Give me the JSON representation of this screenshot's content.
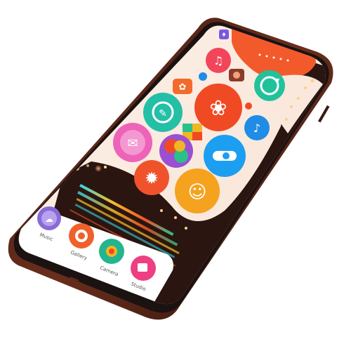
{
  "colors": {
    "bezel": "#1b1212",
    "frame_edge": "#6a2e1c",
    "screen_bg": "#fbe8dc",
    "sunset": "#f25a2c",
    "bokeh_dark": "#2a1510"
  },
  "app_icons": [
    {
      "name": "app-icon-top-small",
      "color": "#7b57e0",
      "glyph": "♦"
    },
    {
      "name": "app-icon-headphones",
      "color": "#f2455a",
      "glyph": "♫"
    },
    {
      "name": "app-icon-settings-small",
      "color": "#f26b2c",
      "glyph": "✿"
    },
    {
      "name": "app-icon-camera-small",
      "color": "#8a3b2a",
      "glyph": "◉"
    },
    {
      "name": "app-icon-refresh",
      "color": "#21c29b",
      "glyph": "↻"
    },
    {
      "name": "app-icon-chat",
      "color": "#24bfa7",
      "glyph": "✎"
    },
    {
      "name": "app-icon-flower-large",
      "color": "#f04a25",
      "glyph": "❀"
    },
    {
      "name": "app-icon-bird",
      "color": "#1f8ce6",
      "glyph": "♪"
    },
    {
      "name": "app-icon-multicolor",
      "color": "#f0b623",
      "glyph": "◆"
    },
    {
      "name": "app-icon-mail",
      "color": "#ee62b8",
      "glyph": "✉"
    },
    {
      "name": "app-icon-palette",
      "color": "#9b4fd1",
      "glyph": "●"
    },
    {
      "name": "app-icon-toggle",
      "color": "#1c9ff0",
      "glyph": "◐"
    },
    {
      "name": "app-icon-gear",
      "color": "#f0522c",
      "glyph": "✹"
    },
    {
      "name": "app-icon-chat-bubble",
      "color": "#f5a21f",
      "glyph": "☺"
    }
  ],
  "dock": [
    {
      "label": "Music",
      "color": "#8a6ad8"
    },
    {
      "label": "Gallery",
      "color": "#f0602a"
    },
    {
      "label": "Camera",
      "color": "#22b58f"
    },
    {
      "label": "Studio",
      "color": "#ee3f82"
    }
  ]
}
